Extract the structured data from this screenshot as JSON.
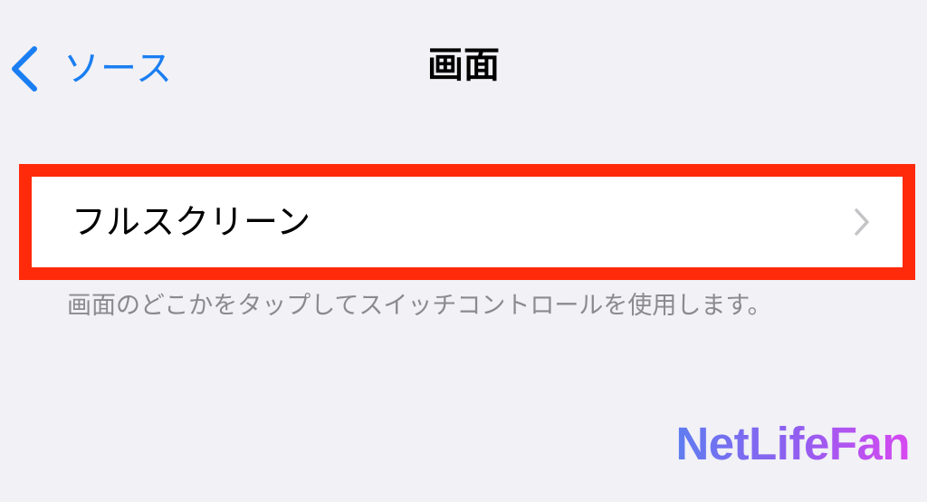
{
  "nav": {
    "back_label": "ソース",
    "title": "画面"
  },
  "list": {
    "items": [
      {
        "label": "フルスクリーン",
        "highlighted": true
      }
    ],
    "footer": "画面のどこかをタップしてスイッチコントロールを使用します。"
  },
  "watermark": {
    "text": "NetLifeFan"
  },
  "colors": {
    "background": "#f1f1f6",
    "accent": "#1a7ef2",
    "highlight_border": "#ff2a09",
    "secondary_text": "#8a8a8f",
    "chevron": "#c4c4c7"
  },
  "icons": {
    "back": "chevron-left-icon",
    "row": "chevron-right-icon"
  }
}
